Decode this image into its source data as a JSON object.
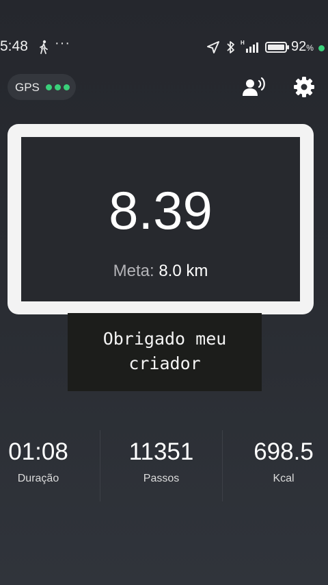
{
  "status_bar": {
    "time": "5:48",
    "more": "···",
    "battery_percent": "92",
    "battery_unit": "%",
    "icons": [
      "walk-icon",
      "navigation-arrow-icon",
      "bluetooth-icon",
      "signal-icon",
      "battery-icon"
    ]
  },
  "header": {
    "gps_label": "GPS",
    "gps_signal_dots": 3,
    "icons": [
      "voice-announce-icon",
      "gear-icon"
    ]
  },
  "goal_card": {
    "distance": "8.39",
    "goal_label": "Meta:",
    "goal_value": "8.0 km"
  },
  "caption": {
    "text": "Obrigado meu\ncriador"
  },
  "stats": [
    {
      "value": "01:08",
      "label": "Duração"
    },
    {
      "value": "11351",
      "label": "Passos"
    },
    {
      "value": "698.5",
      "label": "Kcal"
    }
  ],
  "colors": {
    "background": "#2a2d33",
    "accent_green": "#3ad07a",
    "card_frame": "#f3f3f3",
    "card_inner": "#27292e",
    "caption_bg": "#1c1d1b"
  }
}
